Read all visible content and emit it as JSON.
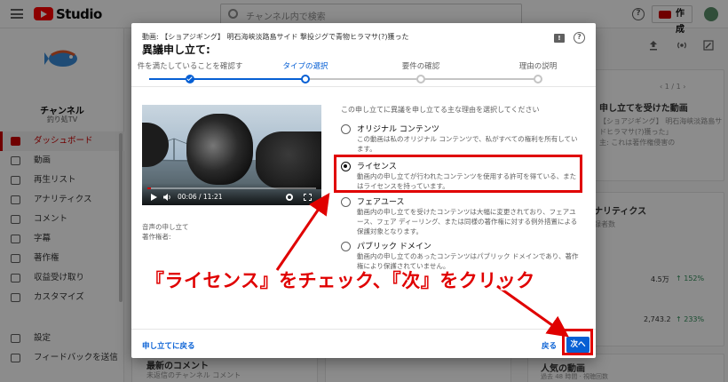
{
  "topbar": {
    "studio_label": "Studio",
    "search_placeholder": "チャンネル内で検索",
    "create_label": "作成"
  },
  "sidebar": {
    "channel_name": "チャンネル",
    "channel_handle": "釣り処TV",
    "items": [
      {
        "label": "ダッシュボード",
        "icon": "dashboard-icon",
        "active": true
      },
      {
        "label": "動画",
        "icon": "video-icon"
      },
      {
        "label": "再生リスト",
        "icon": "playlist-icon"
      },
      {
        "label": "アナリティクス",
        "icon": "analytics-icon"
      },
      {
        "label": "コメント",
        "icon": "comment-icon"
      },
      {
        "label": "字幕",
        "icon": "subtitles-icon"
      },
      {
        "label": "著作権",
        "icon": "copyright-icon"
      },
      {
        "label": "収益受け取り",
        "icon": "dollar-icon"
      },
      {
        "label": "カスタマイズ",
        "icon": "customize-icon"
      }
    ],
    "bottom_items": [
      {
        "label": "設定",
        "icon": "gear-icon"
      },
      {
        "label": "フィードバックを送信",
        "icon": "feedback-icon"
      }
    ]
  },
  "background": {
    "notice_title_fragment": "せ",
    "received_title": "申し立てを受けた動画",
    "pager": "1 / 1",
    "received_line1": "【ショアジギング】 明石海峡淡路島サ",
    "received_line2": "ドヒラマサ(?)獲った」",
    "received_line3": "主: これは著作権侵害の",
    "analytics_fragment": "ナリティクス",
    "subscribers_fragment": "録者数",
    "stat1_value": "4.5万",
    "stat1_change": "↑ 152%",
    "stat2_value": "2,743.2",
    "stat2_change": "↑ 233%",
    "latest_comments": "最新のコメント",
    "comments_sub": "未返信のチャンネル コメント",
    "popular_videos": "人気の動画",
    "popular_sub": "過去 48 時間 · 視聴回数"
  },
  "dialog": {
    "video_title": "動画: 【ショアジギング】 明石海峡淡路島サイド 撃投ジグで青物ヒラマサ(?)獲った",
    "title": "異議申し立て:",
    "steps": [
      {
        "label": "件を満たしていることを確認す",
        "state": "done"
      },
      {
        "label": "タイプの選択",
        "state": "current"
      },
      {
        "label": "要件の確認",
        "state": "future"
      },
      {
        "label": "理由の説明",
        "state": "future"
      }
    ],
    "video": {
      "time": "00:06 / 11:21",
      "progress": 0.01
    },
    "label_claim": "音声の申し立て",
    "label_owner": "著作権者:",
    "reason_prompt": "この申し立てに異議を申し立てる主な理由を選択してください",
    "options": [
      {
        "title": "オリジナル コンテンツ",
        "desc": "この動画は私のオリジナル コンテンツで、私がすべての権利を所有しています。",
        "checked": false
      },
      {
        "title": "ライセンス",
        "desc": "動画内の申し立てが行われたコンテンツを使用する許可を得ている、またはライセンスを持っています。",
        "checked": true
      },
      {
        "title": "フェアユース",
        "desc": "動画内の申し立てを受けたコンテンツは大幅に変更されており、フェアユース、フェア ディーリング、または同様の著作権に対する例外措置による保護対象となります。",
        "checked": false
      },
      {
        "title": "パブリック ドメイン",
        "desc": "動画内の申し立てのあったコンテンツはパブリック ドメインであり、著作権により保護されていません。",
        "checked": false
      }
    ],
    "footer": {
      "back_link": "申し立てに戻る",
      "return_label": "戻る",
      "next_label": "次へ"
    }
  },
  "annotation": {
    "instruction": "『ライセンス』をチェック、『次』をクリック",
    "color": "#e00000"
  }
}
